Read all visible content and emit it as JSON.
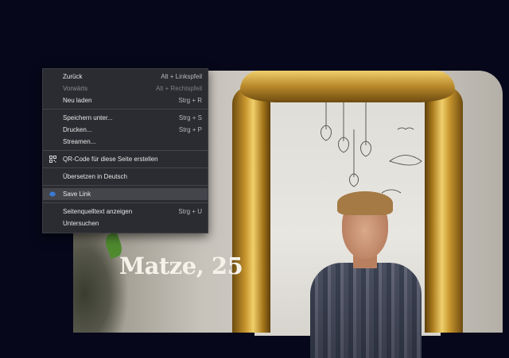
{
  "photo": {
    "caption": "Matze, 25"
  },
  "context_menu": {
    "items": [
      {
        "label": "Zurück",
        "shortcut": "Alt + Linkspfeil",
        "disabled": false
      },
      {
        "label": "Vorwärts",
        "shortcut": "Alt + Rechtspfeil",
        "disabled": true
      },
      {
        "label": "Neu laden",
        "shortcut": "Strg + R",
        "disabled": false
      },
      {
        "label": "Speichern unter...",
        "shortcut": "Strg + S",
        "disabled": false
      },
      {
        "label": "Drucken...",
        "shortcut": "Strg + P",
        "disabled": false
      },
      {
        "label": "Streamen...",
        "shortcut": "",
        "disabled": false
      },
      {
        "label": "QR-Code für diese Seite erstellen",
        "shortcut": "",
        "icon": "qr-code-icon"
      },
      {
        "label": "Übersetzen in Deutsch",
        "shortcut": ""
      },
      {
        "label": "Save Link",
        "shortcut": "",
        "icon": "save-link-extension-icon",
        "highlighted": true
      },
      {
        "label": "Seitenquelltext anzeigen",
        "shortcut": "Strg + U"
      },
      {
        "label": "Untersuchen",
        "shortcut": ""
      }
    ]
  },
  "colors": {
    "page_background": "#06071a",
    "menu_background": "#2b2c31",
    "menu_highlight": "#43454b",
    "save_icon_blue": "#3a7bd5"
  }
}
